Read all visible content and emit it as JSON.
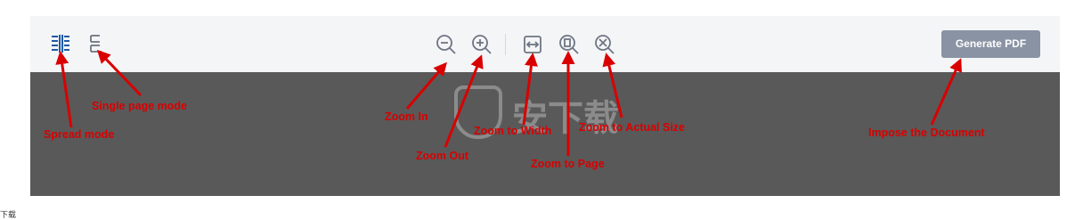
{
  "toolbar": {
    "generate_label": "Generate PDF",
    "icons": {
      "spread": "spread-mode-icon",
      "single": "single-page-icon",
      "zoom_out": "zoom-out-icon",
      "zoom_in": "zoom-in-icon",
      "fit_width": "fit-width-icon",
      "fit_page": "fit-page-icon",
      "actual_size": "actual-size-icon"
    },
    "colors": {
      "toolbar_bg": "#f4f5f7",
      "active_icon": "#1f5aa6",
      "icon": "#6e7583",
      "button_bg": "#8a93a3"
    }
  },
  "viewer": {
    "background": "#595959"
  },
  "annotations": {
    "spread": "Spread mode",
    "single": "Single page mode",
    "zoom_in": "Zoom In",
    "zoom_out": "Zoom Out",
    "zoom_width": "Zoom to Width",
    "zoom_page": "Zoom to Page",
    "zoom_actual": "Zoom to Actual Size",
    "impose": "Impose the Document",
    "color": "#d90000"
  },
  "watermark": {
    "text": "安下载"
  },
  "corner": {
    "text": "下载"
  }
}
